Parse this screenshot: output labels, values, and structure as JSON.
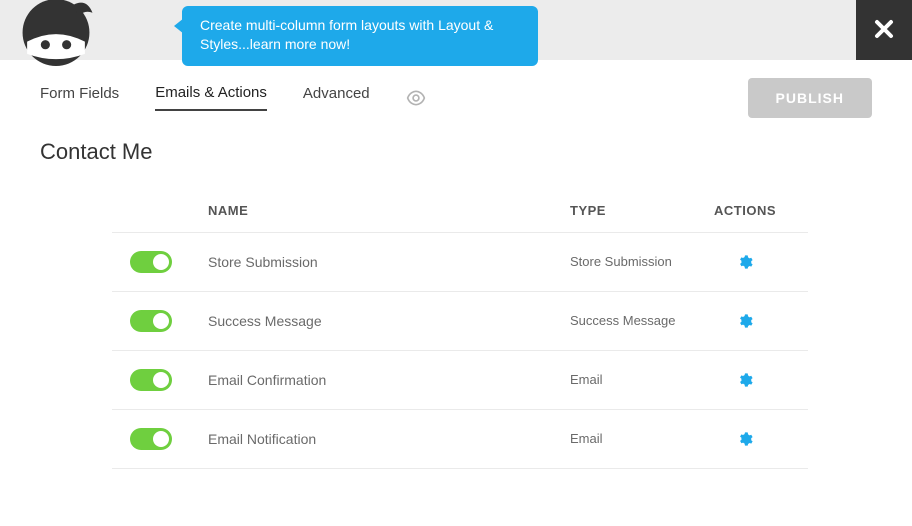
{
  "banner": {
    "promo_text": "Create multi-column form layouts with Layout & Styles...learn more now!"
  },
  "tabs": {
    "form_fields": "Form Fields",
    "emails_actions": "Emails & Actions",
    "advanced": "Advanced"
  },
  "publish_label": "PUBLISH",
  "page_title": "Contact Me",
  "table": {
    "head_name": "NAME",
    "head_type": "TYPE",
    "head_actions": "ACTIONS",
    "rows": [
      {
        "name": "Store Submission",
        "type": "Store Submission"
      },
      {
        "name": "Success Message",
        "type": "Success Message"
      },
      {
        "name": "Email Confirmation",
        "type": "Email"
      },
      {
        "name": "Email Notification",
        "type": "Email"
      }
    ]
  }
}
